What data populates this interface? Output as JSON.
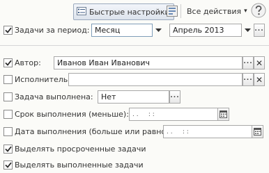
{
  "toolbar": {
    "quick_settings_label": "Быстрые настройки",
    "all_actions_label": "Все действия",
    "dropdown_arrow": "▾"
  },
  "filters": {
    "period": {
      "label": "Задачи за период:",
      "checked": true,
      "period_type": "Месяц",
      "period_value": "Апрель 2013"
    },
    "author": {
      "label": "Автор:",
      "checked": true,
      "value": "Иванов Иван Иванович"
    },
    "executor": {
      "label": "Исполнитель:",
      "checked": false,
      "value": ""
    },
    "completed": {
      "label": "Задача выполнена:",
      "checked": false,
      "value": "Нет"
    },
    "due_less": {
      "label": "Срок выполнения (меньше):",
      "checked": false,
      "value": ". .     : :"
    },
    "done_date_ge": {
      "label": "Дата выполнения (больше или равно):",
      "checked": false,
      "value": ". .     : :"
    },
    "highlight_overdue": {
      "label": "Выделять просроченные задачи",
      "checked": true
    },
    "highlight_completed": {
      "label": "Выделять выполненные задачи",
      "checked": true
    }
  },
  "glyphs": {
    "ellipsis": "...",
    "clear": "✕"
  },
  "colors": {
    "background": "#fbfbf8",
    "field_border": "#a8a8a8",
    "accent_border": "#7f9db9"
  }
}
